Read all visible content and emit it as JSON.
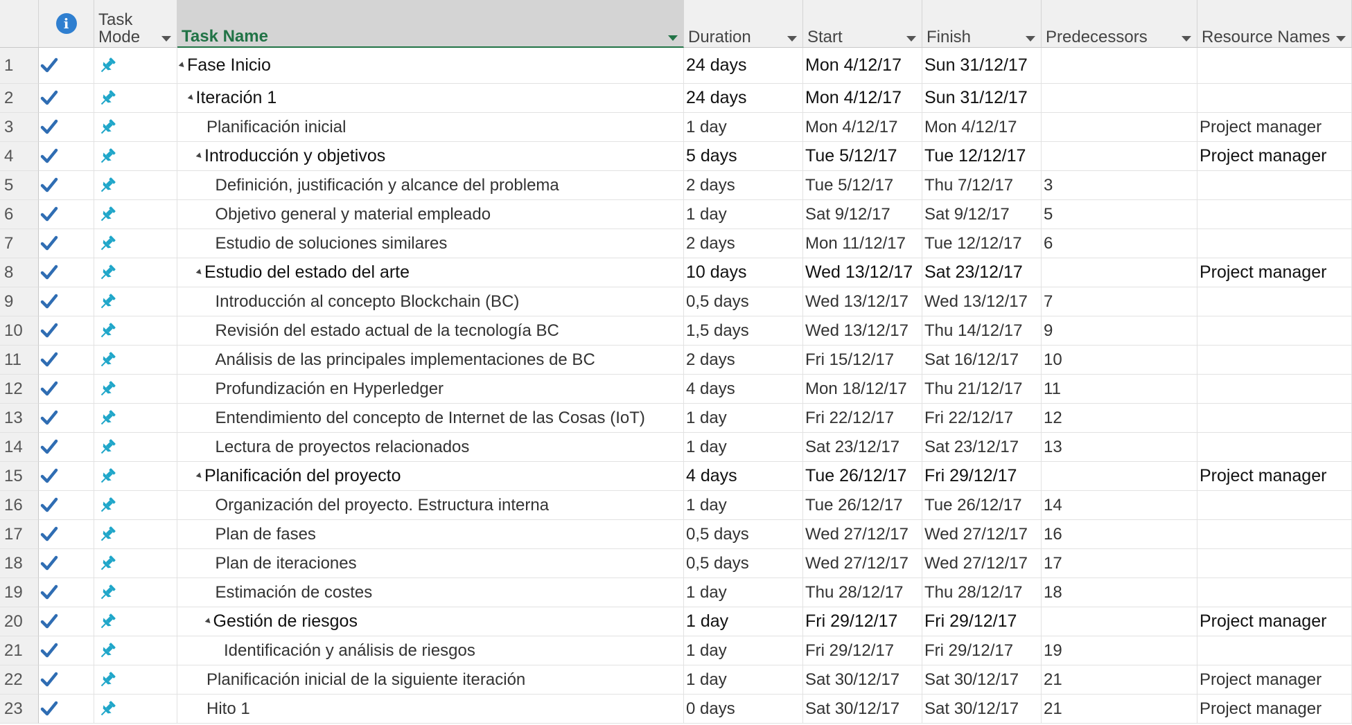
{
  "headers": {
    "indicators_icon": "info-icon",
    "task_mode": "Task\nMode",
    "task_name": "Task Name",
    "duration": "Duration",
    "start": "Start",
    "finish": "Finish",
    "predecessors": "Predecessors",
    "resource_names": "Resource Names"
  },
  "icons": {
    "done": "checkmark-icon",
    "mode": "pin-icon",
    "expand": "collapse-triangle-icon"
  },
  "colors": {
    "accent": "#217346",
    "check": "#2f6db3",
    "pin": "#1fa6c9"
  },
  "rows": [
    {
      "num": "1",
      "name": "Fase Inicio",
      "level": 0,
      "summary": true,
      "duration": "24 days",
      "start": "Mon 4/12/17",
      "finish": "Sun 31/12/17",
      "pred": "",
      "res": ""
    },
    {
      "num": "2",
      "name": "Iteración 1",
      "level": 1,
      "summary": true,
      "duration": "24 days",
      "start": "Mon 4/12/17",
      "finish": "Sun 31/12/17",
      "pred": "",
      "res": ""
    },
    {
      "num": "3",
      "name": "Planificación inicial",
      "level": 2,
      "summary": false,
      "duration": "1 day",
      "start": "Mon 4/12/17",
      "finish": "Mon 4/12/17",
      "pred": "",
      "res": "Project manager"
    },
    {
      "num": "4",
      "name": "Introducción y objetivos",
      "level": 2,
      "summary": true,
      "duration": "5 days",
      "start": "Tue 5/12/17",
      "finish": "Tue 12/12/17",
      "pred": "",
      "res": "Project manager"
    },
    {
      "num": "5",
      "name": "Definición, justificación y alcance del problema",
      "level": 3,
      "summary": false,
      "duration": "2 days",
      "start": "Tue 5/12/17",
      "finish": "Thu 7/12/17",
      "pred": "3",
      "res": ""
    },
    {
      "num": "6",
      "name": "Objetivo general y material empleado",
      "level": 3,
      "summary": false,
      "duration": "1 day",
      "start": "Sat 9/12/17",
      "finish": "Sat 9/12/17",
      "pred": "5",
      "res": ""
    },
    {
      "num": "7",
      "name": "Estudio de soluciones similares",
      "level": 3,
      "summary": false,
      "duration": "2 days",
      "start": "Mon 11/12/17",
      "finish": "Tue 12/12/17",
      "pred": "6",
      "res": ""
    },
    {
      "num": "8",
      "name": "Estudio del estado del arte",
      "level": 2,
      "summary": true,
      "duration": "10 days",
      "start": "Wed 13/12/17",
      "finish": "Sat 23/12/17",
      "pred": "",
      "res": "Project manager"
    },
    {
      "num": "9",
      "name": "Introducción al concepto Blockchain (BC)",
      "level": 3,
      "summary": false,
      "duration": "0,5 days",
      "start": "Wed 13/12/17",
      "finish": "Wed 13/12/17",
      "pred": "7",
      "res": ""
    },
    {
      "num": "10",
      "name": "Revisión del estado actual de la tecnología BC",
      "level": 3,
      "summary": false,
      "duration": "1,5 days",
      "start": "Wed 13/12/17",
      "finish": "Thu 14/12/17",
      "pred": "9",
      "res": ""
    },
    {
      "num": "11",
      "name": "Análisis de las principales implementaciones de BC",
      "level": 3,
      "summary": false,
      "duration": "2 days",
      "start": "Fri 15/12/17",
      "finish": "Sat 16/12/17",
      "pred": "10",
      "res": ""
    },
    {
      "num": "12",
      "name": "Profundización en Hyperledger",
      "level": 3,
      "summary": false,
      "duration": "4 days",
      "start": "Mon 18/12/17",
      "finish": "Thu 21/12/17",
      "pred": "11",
      "res": ""
    },
    {
      "num": "13",
      "name": "Entendimiento del concepto de Internet de las Cosas (IoT)",
      "level": 3,
      "summary": false,
      "duration": "1 day",
      "start": "Fri 22/12/17",
      "finish": "Fri 22/12/17",
      "pred": "12",
      "res": ""
    },
    {
      "num": "14",
      "name": "Lectura de proyectos relacionados",
      "level": 3,
      "summary": false,
      "duration": "1 day",
      "start": "Sat 23/12/17",
      "finish": "Sat 23/12/17",
      "pred": "13",
      "res": ""
    },
    {
      "num": "15",
      "name": "Planificación del proyecto",
      "level": 2,
      "summary": true,
      "duration": "4 days",
      "start": "Tue 26/12/17",
      "finish": "Fri 29/12/17",
      "pred": "",
      "res": "Project manager"
    },
    {
      "num": "16",
      "name": "Organización del proyecto. Estructura interna",
      "level": 3,
      "summary": false,
      "duration": "1 day",
      "start": "Tue 26/12/17",
      "finish": "Tue 26/12/17",
      "pred": "14",
      "res": ""
    },
    {
      "num": "17",
      "name": "Plan de fases",
      "level": 3,
      "summary": false,
      "duration": "0,5 days",
      "start": "Wed 27/12/17",
      "finish": "Wed 27/12/17",
      "pred": "16",
      "res": ""
    },
    {
      "num": "18",
      "name": "Plan de iteraciones",
      "level": 3,
      "summary": false,
      "duration": "0,5 days",
      "start": "Wed 27/12/17",
      "finish": "Wed 27/12/17",
      "pred": "17",
      "res": ""
    },
    {
      "num": "19",
      "name": "Estimación de costes",
      "level": 3,
      "summary": false,
      "duration": "1 day",
      "start": "Thu 28/12/17",
      "finish": "Thu 28/12/17",
      "pred": "18",
      "res": ""
    },
    {
      "num": "20",
      "name": "Gestión de riesgos",
      "level": 3,
      "summary": true,
      "duration": "1 day",
      "start": "Fri 29/12/17",
      "finish": "Fri 29/12/17",
      "pred": "",
      "res": "Project manager"
    },
    {
      "num": "21",
      "name": "Identificación y análisis de riesgos",
      "level": 4,
      "summary": false,
      "duration": "1 day",
      "start": "Fri 29/12/17",
      "finish": "Fri 29/12/17",
      "pred": "19",
      "res": ""
    },
    {
      "num": "22",
      "name": "Planificación inicial de la siguiente iteración",
      "level": 2,
      "summary": false,
      "duration": "1 day",
      "start": "Sat 30/12/17",
      "finish": "Sat 30/12/17",
      "pred": "21",
      "res": "Project manager"
    },
    {
      "num": "23",
      "name": "Hito 1",
      "level": 2,
      "summary": false,
      "duration": "0 days",
      "start": "Sat 30/12/17",
      "finish": "Sat 30/12/17",
      "pred": "21",
      "res": "Project manager"
    }
  ]
}
